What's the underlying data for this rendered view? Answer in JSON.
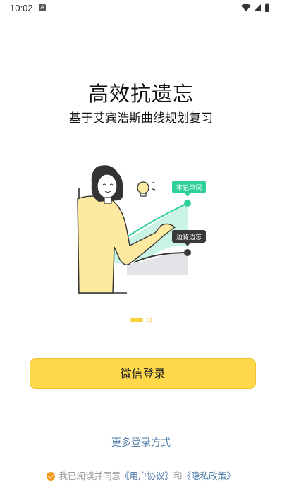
{
  "status_bar": {
    "time": "10:02",
    "app_icon": "A",
    "icons": [
      "wifi-icon",
      "signal-icon",
      "battery-icon"
    ]
  },
  "hero": {
    "title": "高效抗遗忘",
    "subtitle": "基于艾宾浩斯曲线规划复习"
  },
  "illustration": {
    "tag_remember": "牢记单词",
    "tag_forget": "边背边忘",
    "colors": {
      "accent_green": "#2ecf98",
      "tag_dark": "#3a3a3a",
      "shirt": "#fde9a0"
    }
  },
  "carousel": {
    "total": 2,
    "active_index": 0
  },
  "login": {
    "wechat_label": "微信登录",
    "more_label": "更多登录方式"
  },
  "agreement": {
    "prefix": "我已阅读并同意",
    "user_agreement": "《用户协议》",
    "and": "和",
    "privacy_policy": "《隐私政策》",
    "checked": true
  },
  "colors": {
    "primary_button": "#ffd94a",
    "link": "#4a77a8",
    "checkbox": "#f39a1c"
  }
}
